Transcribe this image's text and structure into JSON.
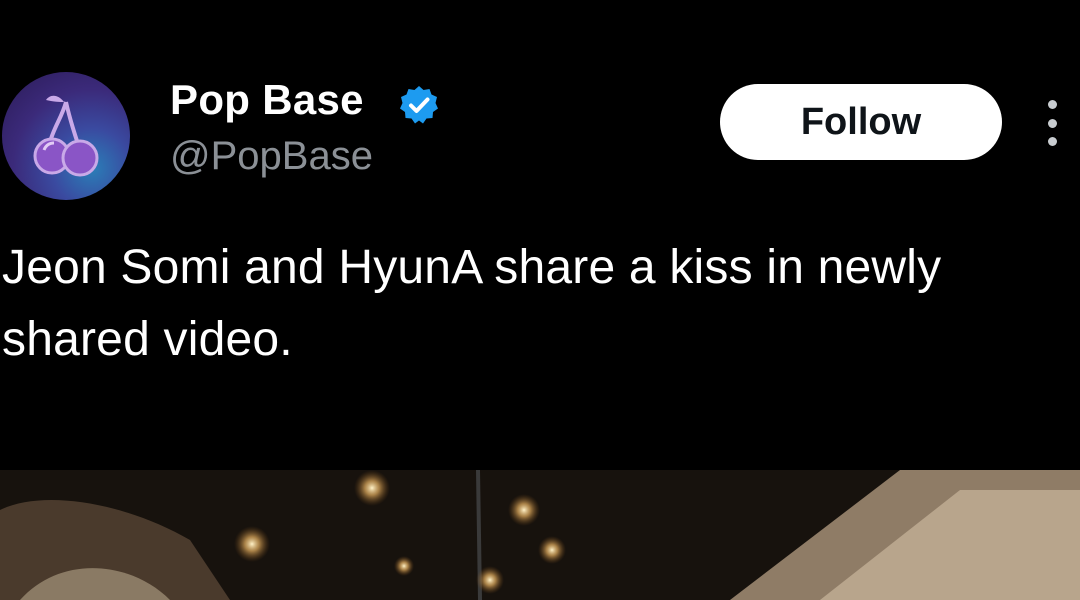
{
  "author": {
    "display_name": "Pop Base",
    "handle": "@PopBase",
    "verified": true,
    "avatar_icon": "cherry-icon"
  },
  "actions": {
    "follow_label": "Follow",
    "more_icon": "more-vertical-icon"
  },
  "tweet": {
    "text": "Jeon Somi and HyunA share a kiss in newly shared video."
  },
  "colors": {
    "background": "#000000",
    "handle_gray": "#8b9096",
    "verified_blue": "#1d9bf0",
    "follow_bg": "#ffffff"
  }
}
